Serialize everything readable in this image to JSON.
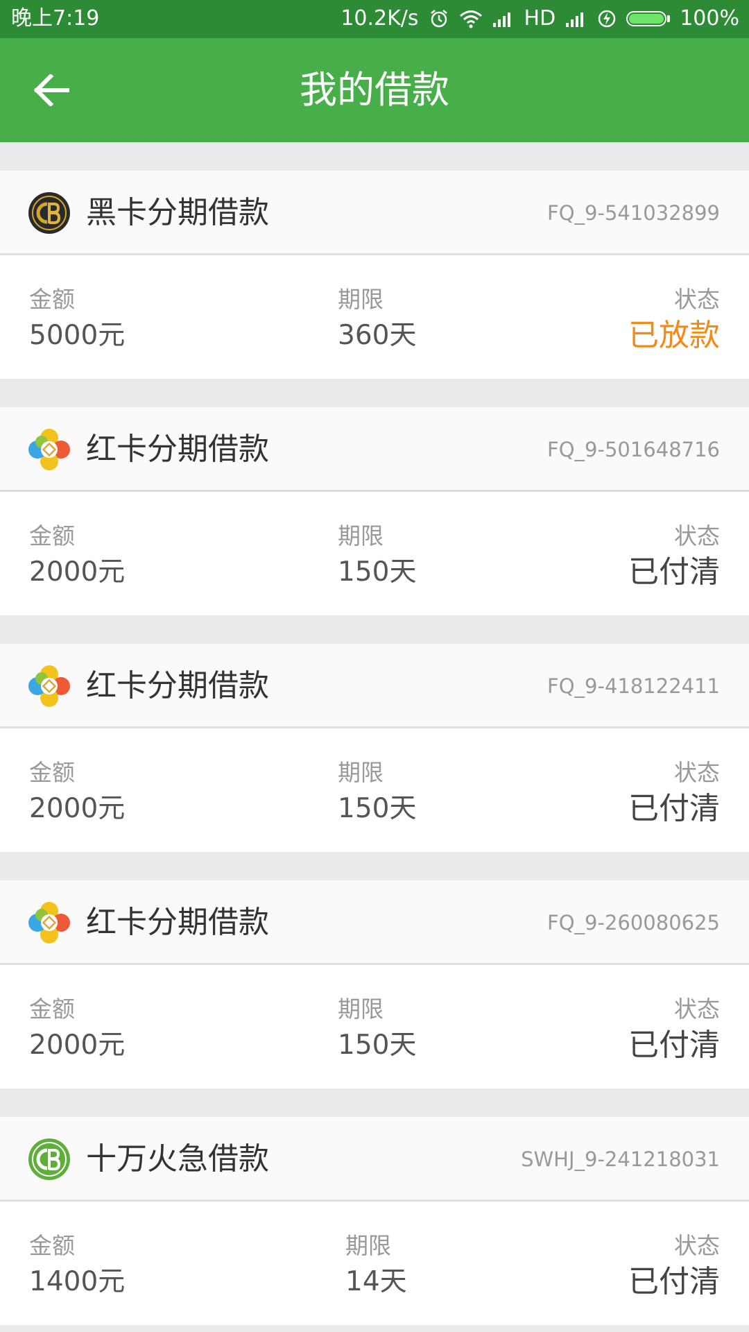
{
  "status_bar": {
    "time": "晚上7:19",
    "net_speed": "10.2K/s",
    "network_type": "HD",
    "battery": "100%",
    "icons": [
      "alarm-icon",
      "wifi-icon",
      "signal-icon",
      "signal-icon",
      "charging-icon",
      "battery-icon"
    ]
  },
  "header": {
    "title": "我的借款",
    "back_icon": "back-arrow-icon"
  },
  "labels": {
    "amount": "金额",
    "term": "期限",
    "status": "状态"
  },
  "colors": {
    "status_bar": "#2e8b35",
    "header": "#47ae49",
    "status_highlight": "#f08a1a"
  },
  "loans": [
    {
      "product": "黑卡分期借款",
      "order_no": "FQ_9-541032899",
      "logo": "black-card-logo-icon",
      "amount": "5000元",
      "term": "360天",
      "status": "已放款",
      "status_highlight": true
    },
    {
      "product": "红卡分期借款",
      "order_no": "FQ_9-501648716",
      "logo": "red-card-logo-icon",
      "amount": "2000元",
      "term": "150天",
      "status": "已付清",
      "status_highlight": false
    },
    {
      "product": "红卡分期借款",
      "order_no": "FQ_9-418122411",
      "logo": "red-card-logo-icon",
      "amount": "2000元",
      "term": "150天",
      "status": "已付清",
      "status_highlight": false
    },
    {
      "product": "红卡分期借款",
      "order_no": "FQ_9-260080625",
      "logo": "red-card-logo-icon",
      "amount": "2000元",
      "term": "150天",
      "status": "已付清",
      "status_highlight": false
    },
    {
      "product": "十万火急借款",
      "order_no": "SWHJ_9-241218031",
      "logo": "swhj-logo-icon",
      "amount": "1400元",
      "term": "14天",
      "status": "已付清",
      "status_highlight": false
    }
  ]
}
